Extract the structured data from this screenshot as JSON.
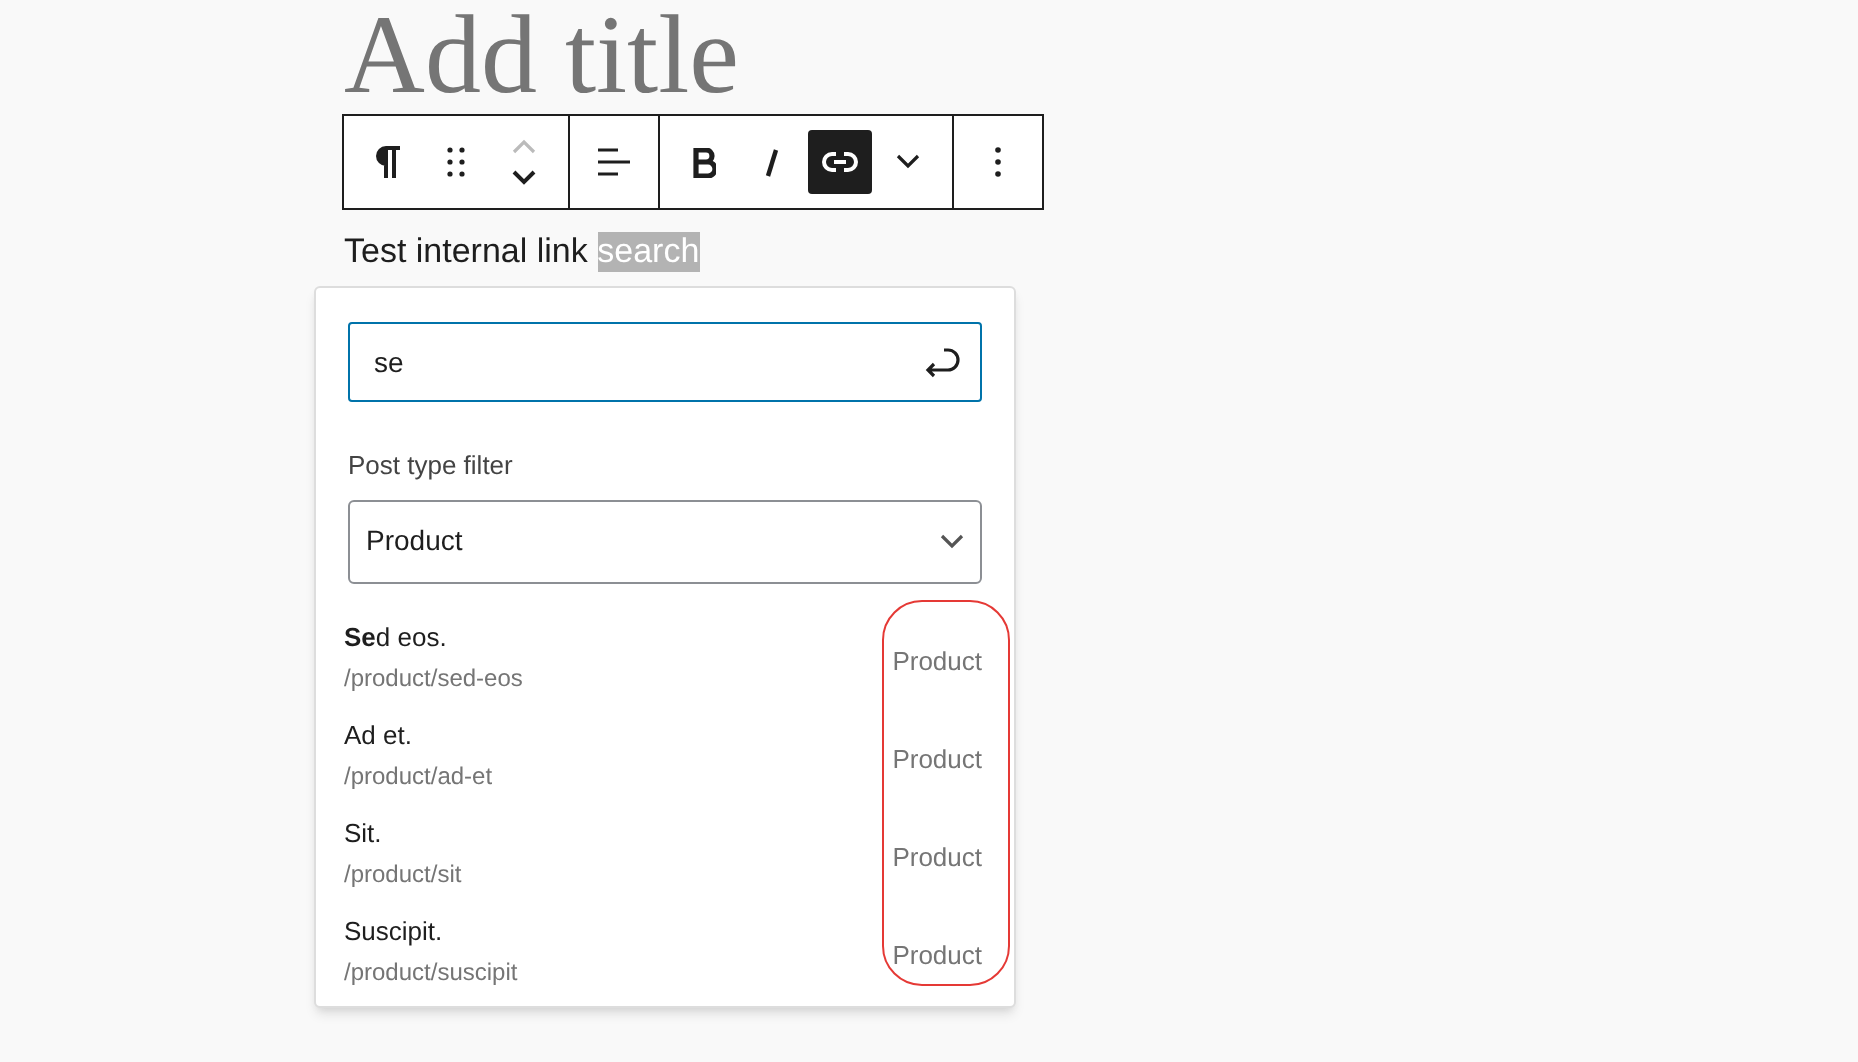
{
  "title_placeholder": "Add title",
  "toolbar": {
    "groups": [
      [
        {
          "kind": "paragraph",
          "selected": false
        },
        {
          "kind": "drag",
          "selected": false
        },
        {
          "kind": "move",
          "selected": false
        }
      ],
      [
        {
          "kind": "align",
          "selected": false
        }
      ],
      [
        {
          "kind": "bold",
          "selected": false
        },
        {
          "kind": "italic",
          "selected": false
        },
        {
          "kind": "link",
          "selected": true
        },
        {
          "kind": "more",
          "selected": false
        }
      ],
      [
        {
          "kind": "options",
          "selected": false
        }
      ]
    ]
  },
  "paragraph": {
    "text": "Test internal link ",
    "selected_text": "search"
  },
  "link_popover": {
    "search_value": "se",
    "filter_label": "Post type filter",
    "filter_value": "Product",
    "type_column_circled": true,
    "results": [
      {
        "title": "**Se**d eos.",
        "url": "/product/sed-eos",
        "type": "Product"
      },
      {
        "title": "Ad et.",
        "url": "/product/ad-et",
        "type": "Product"
      },
      {
        "title": "Sit.",
        "url": "/product/sit",
        "type": "Product"
      },
      {
        "title": "Suscipit.",
        "url": "/product/suscipit",
        "type": "Product"
      }
    ]
  }
}
